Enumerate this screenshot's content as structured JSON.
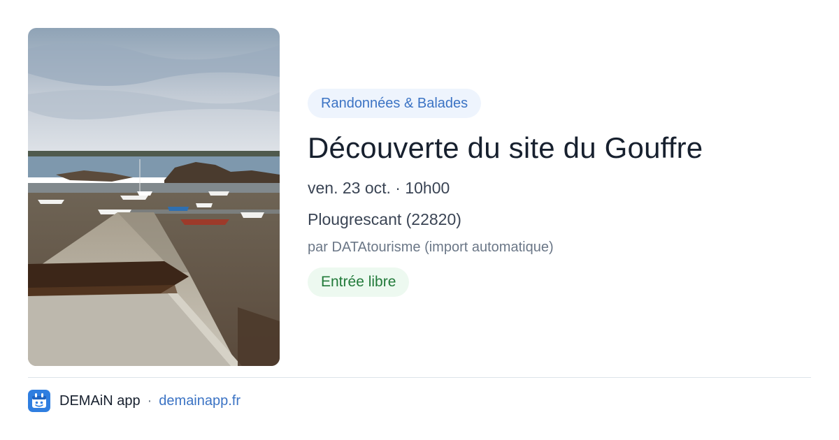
{
  "event": {
    "category": "Randonnées & Balades",
    "title": "Découverte du site du Gouffre",
    "datetime": "ven. 23 oct. · 10h00",
    "location": "Plougrescant (22820)",
    "organizer": "par DATAtourisme (import automatique)",
    "price": "Entrée libre",
    "image": "coastal-low-tide-slipway-photo"
  },
  "footer": {
    "app_name": "DEMAiN app",
    "separator": "·",
    "url": "demainapp.fr",
    "icon": "demain-app-icon"
  },
  "colors": {
    "category_bg": "#eef4fd",
    "category_text": "#3b73c4",
    "price_bg": "#edf9f0",
    "price_text": "#227a3a",
    "title_text": "#17202e",
    "link": "#3b73c4"
  }
}
